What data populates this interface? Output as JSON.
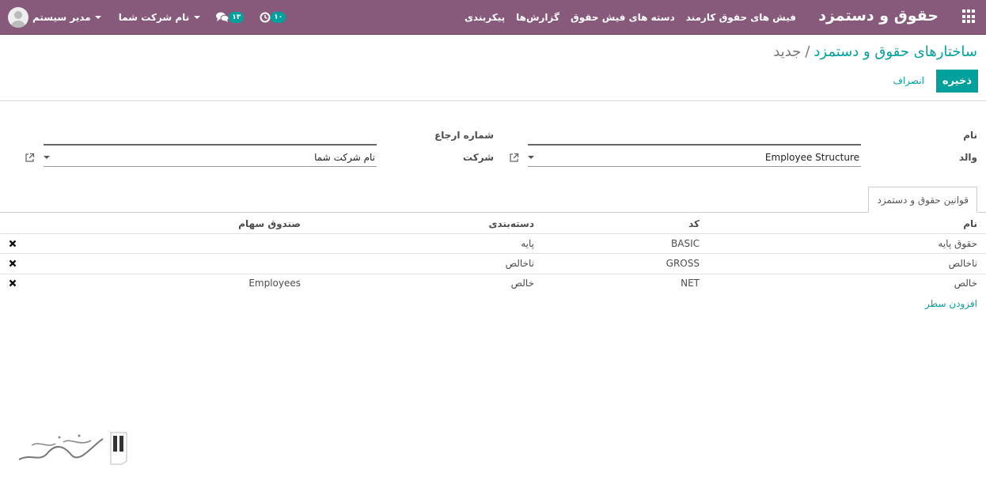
{
  "navbar": {
    "brand": "حقوق و دستمزد",
    "menu": [
      "فیش های حقوق کارمند",
      "دسته های فیش حقوق",
      "گزارش‌ها",
      "پیکربندی"
    ],
    "user_name": "مدیر سیستم",
    "company_name": "نام شرکت شما",
    "messages_count": "۱۳",
    "activities_count": "۱۰",
    "accent_color": "#875a7b"
  },
  "breadcrumb": {
    "parent": "ساختارهای حقوق و دستمزد",
    "separator": "/",
    "current": "جدید"
  },
  "buttons": {
    "save": "ذخیره",
    "discard": "انصراف",
    "save_color": "#00a09d"
  },
  "form": {
    "name_label": "نام",
    "name_value": "",
    "reference_label": "شماره ارجاع",
    "reference_value": "",
    "parent_label": "والد",
    "parent_value": "Employee Structure",
    "company_label": "شرکت",
    "company_value": "نام شرکت شما"
  },
  "notebook": {
    "tab_label": "قوانین حقوق و دستمزد"
  },
  "table": {
    "headers": {
      "name": "نام",
      "code": "کد",
      "category": "دسته‌بندی",
      "fund": "صندوق سهام"
    },
    "rows": [
      {
        "name": "حقوق پایه",
        "code": "BASIC",
        "category": "پایه",
        "fund": ""
      },
      {
        "name": "ناخالص",
        "code": "GROSS",
        "category": "ناخالص",
        "fund": ""
      },
      {
        "name": "خالص",
        "code": "NET",
        "category": "خالص",
        "fund": "Employees"
      }
    ],
    "add_line": "افزودن سطر"
  }
}
